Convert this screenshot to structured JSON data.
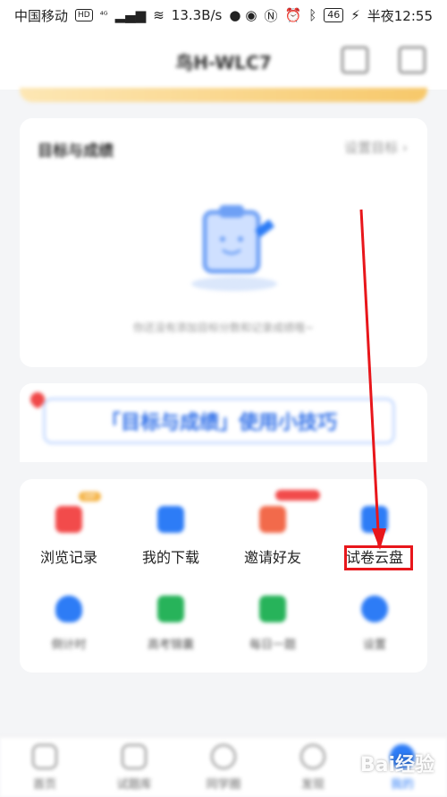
{
  "status_bar": {
    "carrier": "中国移动",
    "hd": "HD",
    "network": "⁴ᴳ",
    "speed": "13.3B/s",
    "battery": "46",
    "time": "半夜12:55"
  },
  "header": {
    "title": "鸟H-WLC7"
  },
  "goal_card": {
    "title": "目标与成绩",
    "link": "设置目标 ›",
    "empty_text": "你还没有添加目标分数和记录成绩哦~"
  },
  "tips_banner": {
    "text": "「目标与成绩」使用小技巧"
  },
  "tools": {
    "row1": [
      {
        "label": "浏览记录",
        "color": "#f24b4b"
      },
      {
        "label": "我的下载",
        "color": "#2d7cf6"
      },
      {
        "label": "邀请好友",
        "color": "#f26a4b"
      },
      {
        "label": "试卷云盘",
        "color": "#2d7cf6"
      }
    ],
    "row2": [
      {
        "label": "倒计时",
        "color": "#2d7cf6"
      },
      {
        "label": "高考锦囊",
        "color": "#27b35a"
      },
      {
        "label": "每日一题",
        "color": "#27b35a"
      },
      {
        "label": "设置",
        "color": "#2d7cf6"
      }
    ]
  },
  "bottom_nav": {
    "items": [
      {
        "label": "首页"
      },
      {
        "label": "试题库"
      },
      {
        "label": "同学圈"
      },
      {
        "label": "发现"
      },
      {
        "label": "我的"
      }
    ]
  },
  "watermark": "Bai经验"
}
